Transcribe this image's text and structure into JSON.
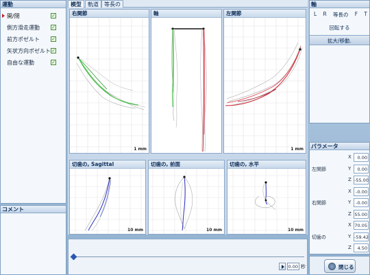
{
  "left_panel": {
    "title": "運動",
    "items": [
      {
        "label": "開/閉",
        "checked": true,
        "selected": true
      },
      {
        "label": "側方滑走運動",
        "checked": true,
        "selected": false
      },
      {
        "label": "前方ポゼルト",
        "checked": true,
        "selected": false
      },
      {
        "label": "矢状方向ポゼルト",
        "checked": true,
        "selected": false
      },
      {
        "label": "自由な運動",
        "checked": true,
        "selected": false
      }
    ]
  },
  "comment_panel": {
    "title": "コメント"
  },
  "tabs": [
    "模型",
    "軌道",
    "等長の"
  ],
  "charts": {
    "right_joint": {
      "title": "右関節",
      "scale": "1 mm"
    },
    "axis": {
      "title": "軸"
    },
    "left_joint": {
      "title": "左関節",
      "scale": "1 mm"
    },
    "incisor_sagittal": {
      "title": "切歯の, Sagittal",
      "scale": "10 mm"
    },
    "incisor_frontal": {
      "title": "切歯の, 前面",
      "scale": "10 mm"
    },
    "incisor_horizontal": {
      "title": "切歯の, 水平",
      "scale": "10 mm"
    }
  },
  "timeline": {
    "time_value": "0.00",
    "time_unit": "秒",
    "position": 0.0
  },
  "right_panel": {
    "title": "軸",
    "view_buttons": [
      "L",
      "R",
      "等長の",
      "F",
      "T"
    ],
    "rotate_label": "回転する",
    "zoom_label": "拡大/移動."
  },
  "parameters": {
    "title": "パラメータ",
    "groups": [
      {
        "name": "左関節",
        "rows": [
          {
            "axis": "X",
            "value": "0.00"
          },
          {
            "axis": "Y",
            "value": "0.00"
          },
          {
            "axis": "Z",
            "value": "-55.00"
          }
        ]
      },
      {
        "name": "右関節",
        "rows": [
          {
            "axis": "X",
            "value": "-0.00"
          },
          {
            "axis": "Y",
            "value": "-0.00"
          },
          {
            "axis": "Z",
            "value": "55.00"
          }
        ]
      },
      {
        "name": "切歯の",
        "rows": [
          {
            "axis": "X",
            "value": "70.05"
          },
          {
            "axis": "Y",
            "value": "-59.42"
          },
          {
            "axis": "Z",
            "value": "4.50"
          }
        ]
      }
    ]
  },
  "close_button": {
    "label": "閉じる"
  },
  "colors": {
    "right_trace": "#3cb83c",
    "left_trace": "#c81e2e",
    "incisor_trace": "#2830b8",
    "gray_trace": "#a0a0a0"
  }
}
